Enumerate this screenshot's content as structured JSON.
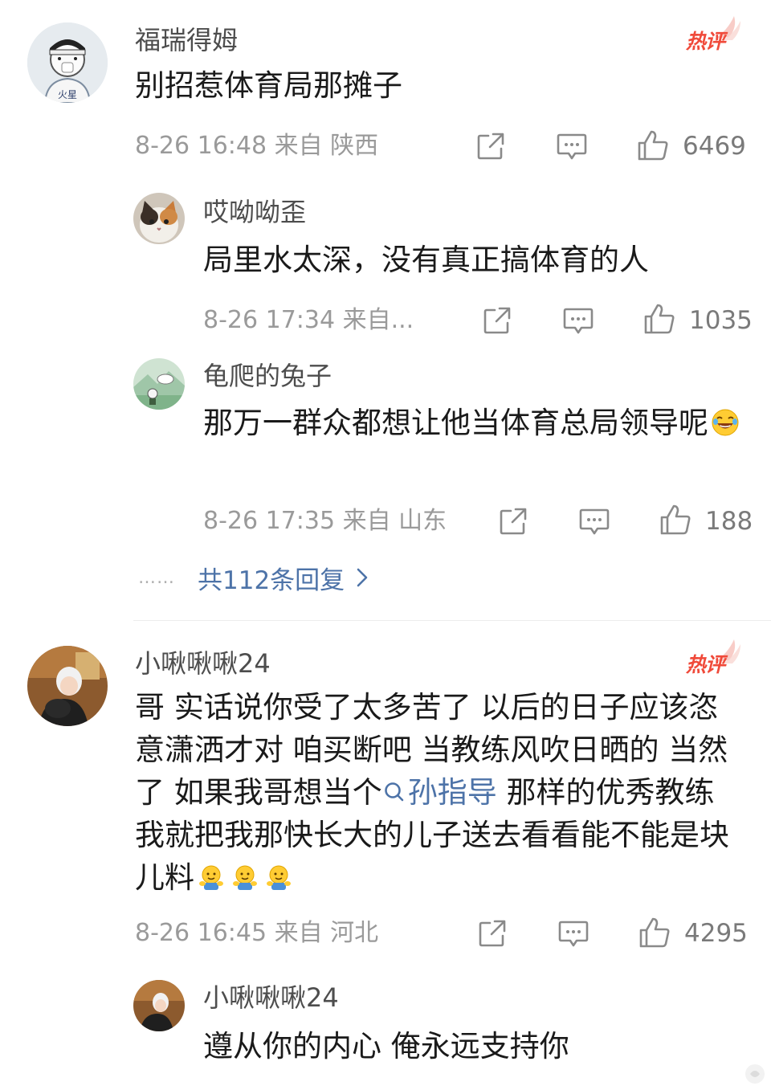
{
  "comments": [
    {
      "user": "福瑞得姆",
      "text": "别招惹体育局那摊子",
      "time": "8-26 16:48 来自 陕西",
      "likes": "6469",
      "hot_label": "热评",
      "replies": [
        {
          "user": "哎呦呦歪",
          "text": "局里水太深，没有真正搞体育的人",
          "time": "8-26 17:34 来自...",
          "likes": "1035"
        },
        {
          "user": "龟爬的兔子",
          "text": "那万一群众都想让他当体育总局领导呢",
          "time": "8-26 17:35 来自 山东",
          "likes": "188"
        }
      ],
      "more_replies": "共112条回复",
      "more_dots": "……"
    },
    {
      "user": "小啾啾啾24",
      "text_parts": {
        "before": "哥 实话说你受了太多苦了  以后的日子应该恣意潇洒才对  咱买断吧 当教练风吹日晒的  当然了  如果我哥想当个",
        "link": "孙指导",
        "after": " 那样的优秀教练 我就把我那快长大的儿子送去看看能不能是块儿料"
      },
      "time": "8-26 16:45 来自 河北",
      "likes": "4295",
      "hot_label": "热评",
      "replies": [
        {
          "user": "小啾啾啾24",
          "text": "遵从你的内心  俺永远支持你"
        }
      ]
    }
  ],
  "icons": {
    "share": "share-icon",
    "comment": "comment-icon",
    "like": "thumbs-up-icon",
    "search": "search-icon",
    "chevron": "chevron-right-icon",
    "laugh": "laughing-emoji",
    "hug": "hug-emoji"
  },
  "colors": {
    "hot": "#f04a3a",
    "link": "#4d73a8",
    "meta": "#9a9a9a"
  }
}
